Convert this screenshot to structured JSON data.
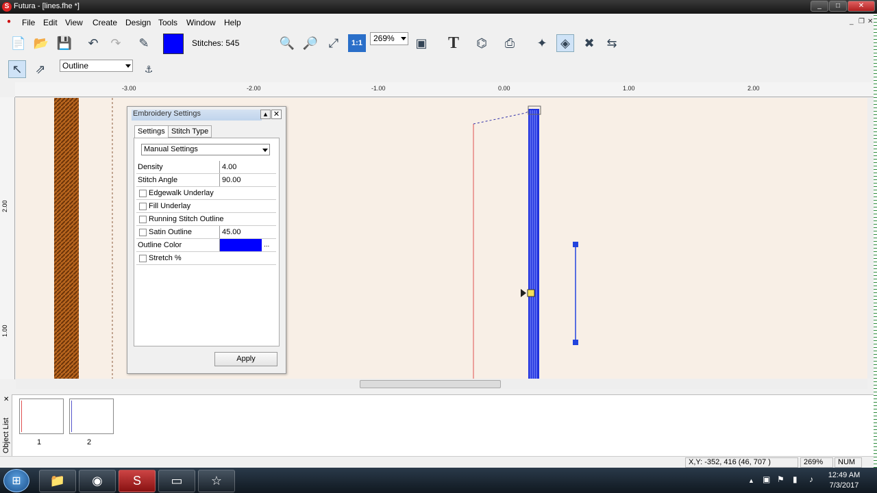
{
  "window": {
    "title": "Futura - [lines.fhe *]",
    "min": "_",
    "max": "□",
    "close": "✕"
  },
  "menu": [
    "File",
    "Edit",
    "View",
    "Create",
    "Design",
    "Tools",
    "Window",
    "Help"
  ],
  "toolbar": {
    "stitches_label": "Stitches: 545",
    "zoom_value": "269%",
    "swatch_color": "#0000ff"
  },
  "toolbar2": {
    "mode_value": "Outline"
  },
  "ruler": {
    "h_ticks": [
      "-3.00",
      "-2.00",
      "-1.00",
      "0.00",
      "1.00",
      "2.00"
    ],
    "v_ticks": [
      "2.00",
      "1.00"
    ]
  },
  "dialog": {
    "title": "Embroidery Settings",
    "tabs": [
      "Settings",
      "Stitch Type"
    ],
    "mode_select": "Manual Settings",
    "density_label": "Density",
    "density_value": "4.00",
    "angle_label": "Stitch Angle",
    "angle_value": "90.00",
    "edgewalk_label": "Edgewalk Underlay",
    "fill_underlay_label": "Fill Underlay",
    "running_label": "Running Stitch Outline",
    "satin_label": "Satin Outline",
    "satin_value": "45.00",
    "outline_color_label": "Outline Color",
    "outline_color_value": "#0000ff",
    "outline_color_more": "...",
    "stretch_label": "Stretch %",
    "apply_label": "Apply"
  },
  "object_list": {
    "label": "Object List",
    "items": [
      "1",
      "2"
    ]
  },
  "status": {
    "coords": "X,Y: -352, 416  (46, 707 )",
    "zoom": "269%",
    "num": "NUM"
  },
  "taskbar": {
    "time": "12:49 AM",
    "date": "7/3/2017"
  }
}
